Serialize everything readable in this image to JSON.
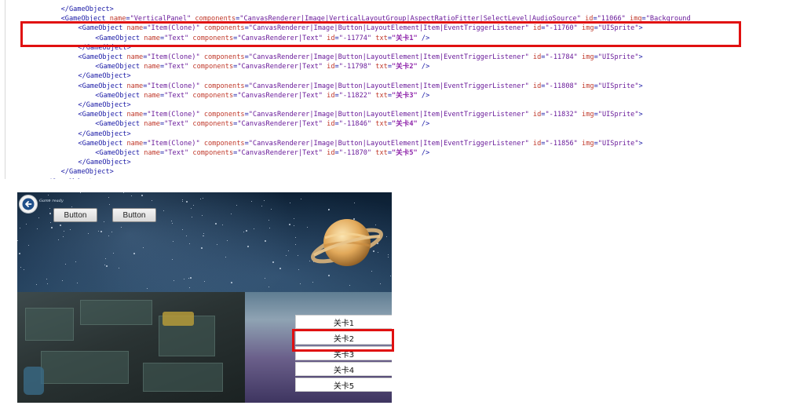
{
  "xml": {
    "lines": [
      {
        "indent": 8,
        "parts": [
          {
            "c": "t-tag",
            "t": "</GameObject>"
          }
        ]
      },
      {
        "indent": 8,
        "parts": [
          {
            "c": "t-tag",
            "t": "<GameObject "
          },
          {
            "c": "t-attr",
            "t": "name"
          },
          {
            "c": "t-tag",
            "t": "="
          },
          {
            "c": "t-val",
            "t": "\"VerticalPanel\""
          },
          {
            "c": "t-attr",
            "t": " components"
          },
          {
            "c": "t-tag",
            "t": "="
          },
          {
            "c": "t-val",
            "t": "\"CanvasRenderer|Image|VerticalLayoutGroup|AspectRatioFitter|SelectLevel|AudioSource\""
          },
          {
            "c": "t-attr",
            "t": " id"
          },
          {
            "c": "t-tag",
            "t": "="
          },
          {
            "c": "t-val",
            "t": "\"11066\""
          },
          {
            "c": "t-attr",
            "t": " img"
          },
          {
            "c": "t-tag",
            "t": "="
          },
          {
            "c": "t-val",
            "t": "\"Background"
          }
        ]
      },
      {
        "indent": 12,
        "parts": [
          {
            "c": "t-tag",
            "t": "<GameObject "
          },
          {
            "c": "t-attr",
            "t": "name"
          },
          {
            "c": "t-tag",
            "t": "="
          },
          {
            "c": "t-val",
            "t": "\"Item(Clone)\""
          },
          {
            "c": "t-attr",
            "t": " components"
          },
          {
            "c": "t-tag",
            "t": "="
          },
          {
            "c": "t-val",
            "t": "\"CanvasRenderer|Image|Button|LayoutElement|Item|EventTriggerListener\""
          },
          {
            "c": "t-attr",
            "t": " id"
          },
          {
            "c": "t-tag",
            "t": "="
          },
          {
            "c": "t-val",
            "t": "\"-11760\""
          },
          {
            "c": "t-attr",
            "t": " img"
          },
          {
            "c": "t-tag",
            "t": "="
          },
          {
            "c": "t-val",
            "t": "\"UISprite\""
          },
          {
            "c": "t-tag",
            "t": ">"
          }
        ]
      },
      {
        "indent": 16,
        "parts": [
          {
            "c": "t-tag",
            "t": "<GameObject "
          },
          {
            "c": "t-attr",
            "t": "name"
          },
          {
            "c": "t-tag",
            "t": "="
          },
          {
            "c": "t-val",
            "t": "\"Text\""
          },
          {
            "c": "t-attr",
            "t": " components"
          },
          {
            "c": "t-tag",
            "t": "="
          },
          {
            "c": "t-val",
            "t": "\"CanvasRenderer|Text\""
          },
          {
            "c": "t-attr",
            "t": " id"
          },
          {
            "c": "t-tag",
            "t": "="
          },
          {
            "c": "t-val",
            "t": "\"-11774\""
          },
          {
            "c": "t-attr",
            "t": " txt"
          },
          {
            "c": "t-tag",
            "t": "="
          },
          {
            "c": "t-txt",
            "t": "\"关卡1\""
          },
          {
            "c": "t-tag",
            "t": " />"
          }
        ]
      },
      {
        "indent": 12,
        "parts": [
          {
            "c": "t-tag",
            "t": "</GameObject>"
          }
        ]
      },
      {
        "indent": 12,
        "parts": [
          {
            "c": "t-tag",
            "t": "<GameObject "
          },
          {
            "c": "t-attr",
            "t": "name"
          },
          {
            "c": "t-tag",
            "t": "="
          },
          {
            "c": "t-val",
            "t": "\"Item(Clone)\""
          },
          {
            "c": "t-attr",
            "t": " components"
          },
          {
            "c": "t-tag",
            "t": "="
          },
          {
            "c": "t-val",
            "t": "\"CanvasRenderer|Image|Button|LayoutElement|Item|EventTriggerListener\""
          },
          {
            "c": "t-attr",
            "t": " id"
          },
          {
            "c": "t-tag",
            "t": "="
          },
          {
            "c": "t-val",
            "t": "\"-11784\""
          },
          {
            "c": "t-attr",
            "t": " img"
          },
          {
            "c": "t-tag",
            "t": "="
          },
          {
            "c": "t-val",
            "t": "\"UISprite\""
          },
          {
            "c": "t-tag",
            "t": ">"
          }
        ]
      },
      {
        "indent": 16,
        "parts": [
          {
            "c": "t-tag",
            "t": "<GameObject "
          },
          {
            "c": "t-attr",
            "t": "name"
          },
          {
            "c": "t-tag",
            "t": "="
          },
          {
            "c": "t-val",
            "t": "\"Text\""
          },
          {
            "c": "t-attr",
            "t": " components"
          },
          {
            "c": "t-tag",
            "t": "="
          },
          {
            "c": "t-val",
            "t": "\"CanvasRenderer|Text\""
          },
          {
            "c": "t-attr",
            "t": " id"
          },
          {
            "c": "t-tag",
            "t": "="
          },
          {
            "c": "t-val",
            "t": "\"-11798\""
          },
          {
            "c": "t-attr",
            "t": " txt"
          },
          {
            "c": "t-tag",
            "t": "="
          },
          {
            "c": "t-txt",
            "t": "\"关卡2\""
          },
          {
            "c": "t-tag",
            "t": " />"
          }
        ]
      },
      {
        "indent": 12,
        "parts": [
          {
            "c": "t-tag",
            "t": "</GameObject>"
          }
        ]
      },
      {
        "indent": 12,
        "parts": [
          {
            "c": "t-tag",
            "t": "<GameObject "
          },
          {
            "c": "t-attr",
            "t": "name"
          },
          {
            "c": "t-tag",
            "t": "="
          },
          {
            "c": "t-val",
            "t": "\"Item(Clone)\""
          },
          {
            "c": "t-attr",
            "t": " components"
          },
          {
            "c": "t-tag",
            "t": "="
          },
          {
            "c": "t-val",
            "t": "\"CanvasRenderer|Image|Button|LayoutElement|Item|EventTriggerListener\""
          },
          {
            "c": "t-attr",
            "t": " id"
          },
          {
            "c": "t-tag",
            "t": "="
          },
          {
            "c": "t-val",
            "t": "\"-11808\""
          },
          {
            "c": "t-attr",
            "t": " img"
          },
          {
            "c": "t-tag",
            "t": "="
          },
          {
            "c": "t-val",
            "t": "\"UISprite\""
          },
          {
            "c": "t-tag",
            "t": ">"
          }
        ]
      },
      {
        "indent": 16,
        "parts": [
          {
            "c": "t-tag",
            "t": "<GameObject "
          },
          {
            "c": "t-attr",
            "t": "name"
          },
          {
            "c": "t-tag",
            "t": "="
          },
          {
            "c": "t-val",
            "t": "\"Text\""
          },
          {
            "c": "t-attr",
            "t": " components"
          },
          {
            "c": "t-tag",
            "t": "="
          },
          {
            "c": "t-val",
            "t": "\"CanvasRenderer|Text\""
          },
          {
            "c": "t-attr",
            "t": " id"
          },
          {
            "c": "t-tag",
            "t": "="
          },
          {
            "c": "t-val",
            "t": "\"-11822\""
          },
          {
            "c": "t-attr",
            "t": " txt"
          },
          {
            "c": "t-tag",
            "t": "="
          },
          {
            "c": "t-txt",
            "t": "\"关卡3\""
          },
          {
            "c": "t-tag",
            "t": " />"
          }
        ]
      },
      {
        "indent": 12,
        "parts": [
          {
            "c": "t-tag",
            "t": "</GameObject>"
          }
        ]
      },
      {
        "indent": 12,
        "parts": [
          {
            "c": "t-tag",
            "t": "<GameObject "
          },
          {
            "c": "t-attr",
            "t": "name"
          },
          {
            "c": "t-tag",
            "t": "="
          },
          {
            "c": "t-val",
            "t": "\"Item(Clone)\""
          },
          {
            "c": "t-attr",
            "t": " components"
          },
          {
            "c": "t-tag",
            "t": "="
          },
          {
            "c": "t-val",
            "t": "\"CanvasRenderer|Image|Button|LayoutElement|Item|EventTriggerListener\""
          },
          {
            "c": "t-attr",
            "t": " id"
          },
          {
            "c": "t-tag",
            "t": "="
          },
          {
            "c": "t-val",
            "t": "\"-11832\""
          },
          {
            "c": "t-attr",
            "t": " img"
          },
          {
            "c": "t-tag",
            "t": "="
          },
          {
            "c": "t-val",
            "t": "\"UISprite\""
          },
          {
            "c": "t-tag",
            "t": ">"
          }
        ]
      },
      {
        "indent": 16,
        "parts": [
          {
            "c": "t-tag",
            "t": "<GameObject "
          },
          {
            "c": "t-attr",
            "t": "name"
          },
          {
            "c": "t-tag",
            "t": "="
          },
          {
            "c": "t-val",
            "t": "\"Text\""
          },
          {
            "c": "t-attr",
            "t": " components"
          },
          {
            "c": "t-tag",
            "t": "="
          },
          {
            "c": "t-val",
            "t": "\"CanvasRenderer|Text\""
          },
          {
            "c": "t-attr",
            "t": " id"
          },
          {
            "c": "t-tag",
            "t": "="
          },
          {
            "c": "t-val",
            "t": "\"-11846\""
          },
          {
            "c": "t-attr",
            "t": " txt"
          },
          {
            "c": "t-tag",
            "t": "="
          },
          {
            "c": "t-txt",
            "t": "\"关卡4\""
          },
          {
            "c": "t-tag",
            "t": " />"
          }
        ]
      },
      {
        "indent": 12,
        "parts": [
          {
            "c": "t-tag",
            "t": "</GameObject>"
          }
        ]
      },
      {
        "indent": 12,
        "parts": [
          {
            "c": "t-tag",
            "t": "<GameObject "
          },
          {
            "c": "t-attr",
            "t": "name"
          },
          {
            "c": "t-tag",
            "t": "="
          },
          {
            "c": "t-val",
            "t": "\"Item(Clone)\""
          },
          {
            "c": "t-attr",
            "t": " components"
          },
          {
            "c": "t-tag",
            "t": "="
          },
          {
            "c": "t-val",
            "t": "\"CanvasRenderer|Image|Button|LayoutElement|Item|EventTriggerListener\""
          },
          {
            "c": "t-attr",
            "t": " id"
          },
          {
            "c": "t-tag",
            "t": "="
          },
          {
            "c": "t-val",
            "t": "\"-11856\""
          },
          {
            "c": "t-attr",
            "t": " img"
          },
          {
            "c": "t-tag",
            "t": "="
          },
          {
            "c": "t-val",
            "t": "\"UISprite\""
          },
          {
            "c": "t-tag",
            "t": ">"
          }
        ]
      },
      {
        "indent": 16,
        "parts": [
          {
            "c": "t-tag",
            "t": "<GameObject "
          },
          {
            "c": "t-attr",
            "t": "name"
          },
          {
            "c": "t-tag",
            "t": "="
          },
          {
            "c": "t-val",
            "t": "\"Text\""
          },
          {
            "c": "t-attr",
            "t": " components"
          },
          {
            "c": "t-tag",
            "t": "="
          },
          {
            "c": "t-val",
            "t": "\"CanvasRenderer|Text\""
          },
          {
            "c": "t-attr",
            "t": " id"
          },
          {
            "c": "t-tag",
            "t": "="
          },
          {
            "c": "t-val",
            "t": "\"-11870\""
          },
          {
            "c": "t-attr",
            "t": " txt"
          },
          {
            "c": "t-tag",
            "t": "="
          },
          {
            "c": "t-txt",
            "t": "\"关卡5\""
          },
          {
            "c": "t-tag",
            "t": " />"
          }
        ]
      },
      {
        "indent": 12,
        "parts": [
          {
            "c": "t-tag",
            "t": "</GameObject>"
          }
        ]
      },
      {
        "indent": 8,
        "parts": [
          {
            "c": "t-tag",
            "t": "</GameObject>"
          }
        ]
      },
      {
        "indent": 4,
        "parts": [
          {
            "c": "t-tag",
            "t": "</GameObject>"
          }
        ]
      }
    ],
    "highlight_color": "#e01010"
  },
  "game": {
    "logo_text": "Game ready",
    "buttons": [
      "Button",
      "Button"
    ],
    "levels": [
      "关卡1",
      "关卡2",
      "关卡3",
      "关卡4",
      "关卡5"
    ],
    "selected_level": "关卡2",
    "icons": {
      "back": "back-arrow-icon",
      "planet": "planet-icon"
    }
  }
}
